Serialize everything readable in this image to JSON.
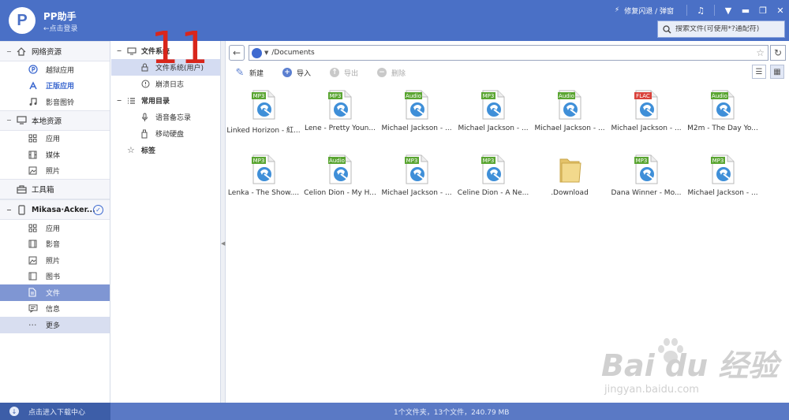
{
  "app": {
    "title": "PP助手",
    "login": "←点击登录",
    "logo_letter": "P"
  },
  "topbar": {
    "repair": "修复闪退 / 弹窗"
  },
  "search": {
    "placeholder": "搜索文件(可使用*?通配符)"
  },
  "sidebar": {
    "sections": [
      {
        "label": "网络资源",
        "items": [
          {
            "label": "越狱应用"
          },
          {
            "label": "正版应用"
          },
          {
            "label": "影音图铃"
          }
        ]
      },
      {
        "label": "本地资源",
        "items": [
          {
            "label": "应用"
          },
          {
            "label": "媒体"
          },
          {
            "label": "照片"
          }
        ]
      },
      {
        "label": "工具箱",
        "items": []
      },
      {
        "label": "Mikasa·Acker...",
        "items": [
          {
            "label": "应用"
          },
          {
            "label": "影音"
          },
          {
            "label": "照片"
          },
          {
            "label": "图书"
          },
          {
            "label": "文件"
          },
          {
            "label": "信息"
          },
          {
            "label": "更多"
          }
        ]
      }
    ]
  },
  "tree": {
    "filesystem": "文件系统",
    "filesystem_user": "文件系统(用户)",
    "crash_log": "崩溃日志",
    "common_dirs": "常用目录",
    "voice_memo": "语音备忘录",
    "mobile_disk": "移动硬盘",
    "tags": "标签"
  },
  "nav": {
    "path": "/Documents"
  },
  "toolbar": {
    "new": "新建",
    "import": "导入",
    "export": "导出",
    "delete": "删除"
  },
  "files": [
    {
      "name": "Linked Horizon - 紅...",
      "badge": "MP3",
      "badge_color": "#5aa532"
    },
    {
      "name": "Lene - Pretty Youn...",
      "badge": "MP3",
      "badge_color": "#5aa532"
    },
    {
      "name": "Michael Jackson - ...",
      "badge": "Audio",
      "badge_color": "#5aa532"
    },
    {
      "name": "Michael Jackson - ...",
      "badge": "MP3",
      "badge_color": "#5aa532"
    },
    {
      "name": "Michael Jackson - ...",
      "badge": "Audio",
      "badge_color": "#5aa532"
    },
    {
      "name": "Michael Jackson - ...",
      "badge": "FLAC",
      "badge_color": "#d9423b"
    },
    {
      "name": "M2m - The Day Yo...",
      "badge": "Audio",
      "badge_color": "#5aa532"
    },
    {
      "name": "Lenka - The Show....",
      "badge": "MP3",
      "badge_color": "#5aa532"
    },
    {
      "name": "Celion Dion - My H...",
      "badge": "Audio",
      "badge_color": "#5aa532"
    },
    {
      "name": "Michael Jackson - ...",
      "badge": "MP3",
      "badge_color": "#5aa532"
    },
    {
      "name": "Celine Dion - A Ne...",
      "badge": "MP3",
      "badge_color": "#5aa532"
    },
    {
      "name": ".Download",
      "badge": "",
      "badge_color": ""
    },
    {
      "name": "Dana Winner - Mo...",
      "badge": "MP3",
      "badge_color": "#5aa532"
    },
    {
      "name": "Michael Jackson - ...",
      "badge": "MP3",
      "badge_color": "#5aa532"
    }
  ],
  "status": {
    "download": "点击进入下载中心",
    "summary": "1个文件夹，13个文件，240.79 MB"
  },
  "annotation": "11",
  "watermark": {
    "brand": "Bai du 经验",
    "url": "jingyan.baidu.com"
  },
  "colors": {
    "primary": "#4a70c6",
    "active": "#7f96d3",
    "annotation": "#d8261c"
  }
}
